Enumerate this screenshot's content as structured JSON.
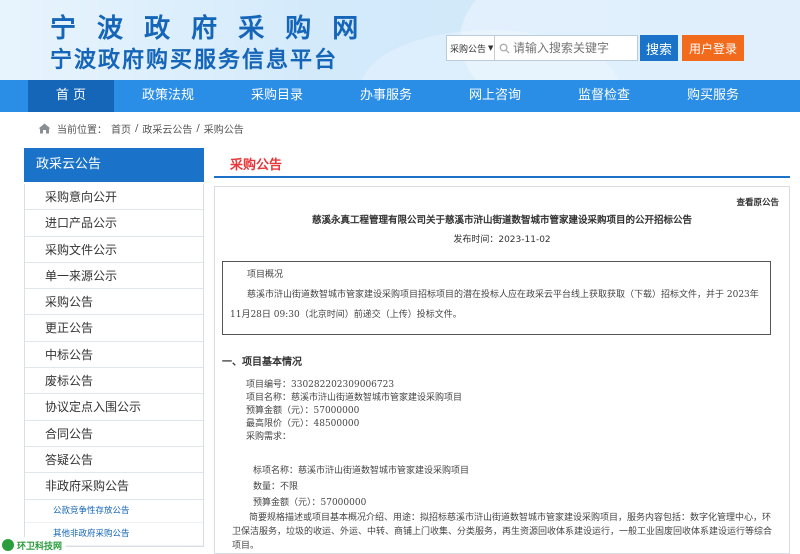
{
  "header": {
    "title": "宁 波 政 府 采 购 网",
    "subtitle": "宁波政府购买服务信息平台"
  },
  "search": {
    "scope": "采购公告",
    "placeholder": "请输入搜索关键字",
    "button": "搜索",
    "login": "用户登录"
  },
  "nav": {
    "items": [
      "首 页",
      "政策法规",
      "采购目录",
      "办事服务",
      "网上咨询",
      "监督检查",
      "购买服务"
    ],
    "active_index": 0
  },
  "breadcrumb": {
    "label": "当前位置：",
    "items": [
      "首页",
      "/",
      "政采云公告",
      "/",
      "采购公告"
    ]
  },
  "sidebar": {
    "title": "政采云公告",
    "items": [
      "采购意向公开",
      "进口产品公示",
      "采购文件公示",
      "单一来源公示",
      "采购公告",
      "更正公告",
      "中标公告",
      "废标公告",
      "协议定点入围公示",
      "合同公告",
      "答疑公告",
      "非政府采购公告"
    ],
    "subitems": [
      "公款竞争性存放公告",
      "其他非政府采购公告"
    ]
  },
  "main": {
    "section_title": "采购公告",
    "view_original": "查看原公告",
    "notice_title": "慈溪永真工程管理有限公司关于慈溪市浒山街道数智城市管家建设采购项目的公开招标公告",
    "publish_date": "发布时间：2023-11-02",
    "overview_heading": "项目概况",
    "overview_text": "慈溪市浒山街道数智城市管家建设采购项目招标项目的潜在投标人应在政采云平台线上获取获取（下载）招标文件，并于 2023年11月28日 09:30（北京时间）前递交（上传）投标文件。",
    "section1": "一、项目基本情况",
    "info": [
      "项目编号：330282202309006723",
      "项目名称：慈溪市浒山街道数智城市管家建设采购项目",
      "预算金额（元）：57000000",
      "最高限价（元）：48500000",
      "采购需求："
    ],
    "lot": [
      "标项名称：慈溪市浒山街道数智城市管家建设采购项目",
      "数量：不限",
      "预算金额（元）：57000000"
    ],
    "description": "简要规格描述或项目基本概况介绍、用途：拟招标慈溪市浒山街道数智城市管家建设采购项目，服务内容包括：数字化管理中心，环卫保洁服务，垃圾的收运、外运、中转、商铺上门收集、分类服务，再生资源回收体系建设运行，一般工业固废回收体系建设运行等综合项目。"
  },
  "watermark": "环卫科技网",
  "colors": {
    "brand_blue": "#1a73c9",
    "nav_blue": "#2b8ee6",
    "nav_active": "#1565b8",
    "login_orange": "#f26b1d",
    "section_red": "#e5383b"
  }
}
